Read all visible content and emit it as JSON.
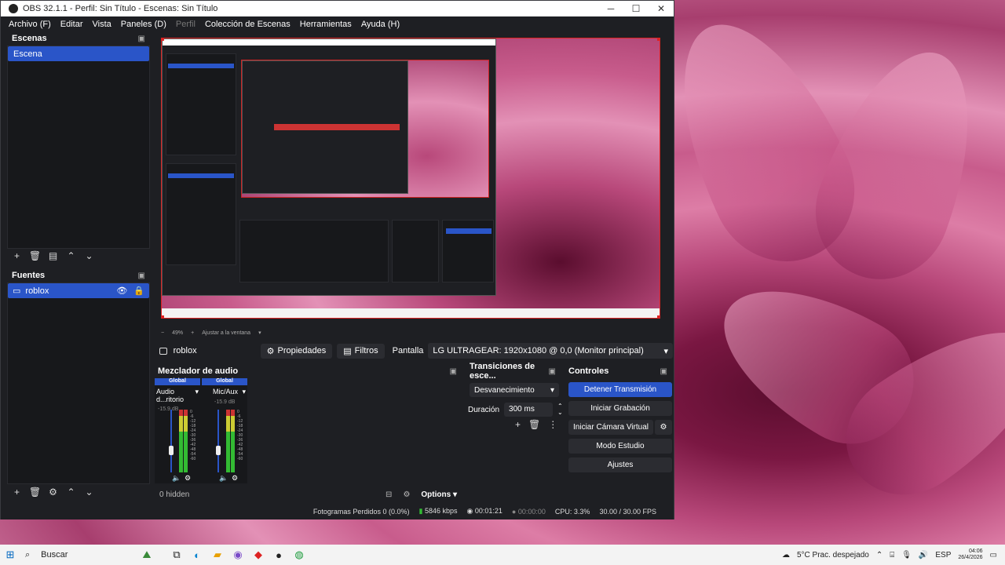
{
  "window": {
    "title": "OBS 32.1.1 - Perfil: Sin Título - Escenas: Sin Título",
    "min": "─",
    "max": "☐",
    "close": "✕"
  },
  "menu": [
    "Archivo (F)",
    "Editar",
    "Vista",
    "Paneles (D)",
    "Perfil",
    "Colección de Escenas",
    "Herramientas",
    "Ayuda (H)"
  ],
  "scenes": {
    "title": "Escenas",
    "items": [
      "Escena"
    ]
  },
  "sources": {
    "title": "Fuentes",
    "items": [
      "roblox"
    ]
  },
  "preview": {
    "zoom": "49%",
    "fit": "Ajustar a la ventana"
  },
  "context": {
    "source": "roblox",
    "properties": "Propiedades",
    "filters": "Filtros",
    "display_label": "Pantalla",
    "display_value": "LG ULTRAGEAR: 1920x1080 @ 0,0 (Monitor principal)"
  },
  "mixer": {
    "title": "Mezclador de audio",
    "channels": [
      {
        "tag": "Global",
        "name": "Audio d...ritorio",
        "db": "-15.9 dB"
      },
      {
        "tag": "Global",
        "name": "Mic/Aux",
        "db": "-15.9 dB"
      }
    ],
    "scale": [
      "0",
      "-6",
      "-12",
      "-18",
      "-24",
      "-30",
      "-36",
      "-42",
      "-48",
      "-54",
      "-60"
    ],
    "hidden": "0 hidden",
    "options": "Options"
  },
  "transitions": {
    "title": "Transiciones de esce...",
    "selected": "Desvanecimiento",
    "duration_label": "Duración",
    "duration_value": "300 ms"
  },
  "controls": {
    "title": "Controles",
    "stop_stream": "Detener Transmisión",
    "start_record": "Iniciar Grabación",
    "virtual_cam": "Iniciar Cámara Virtual",
    "studio": "Modo Estudio",
    "settings": "Ajustes"
  },
  "status": {
    "dropped": "Fotogramas Perdidos 0 (0.0%)",
    "bitrate": "5846 kbps",
    "stream_time": "00:01:21",
    "rec_time": "00:00:00",
    "cpu": "CPU: 3.3%",
    "fps": "30.00 / 30.00 FPS"
  },
  "taskbar": {
    "search": "Buscar",
    "weather": "5°C  Prac. despejado",
    "lang": "ESP",
    "time": "04:06",
    "date": "26/4/2026"
  }
}
